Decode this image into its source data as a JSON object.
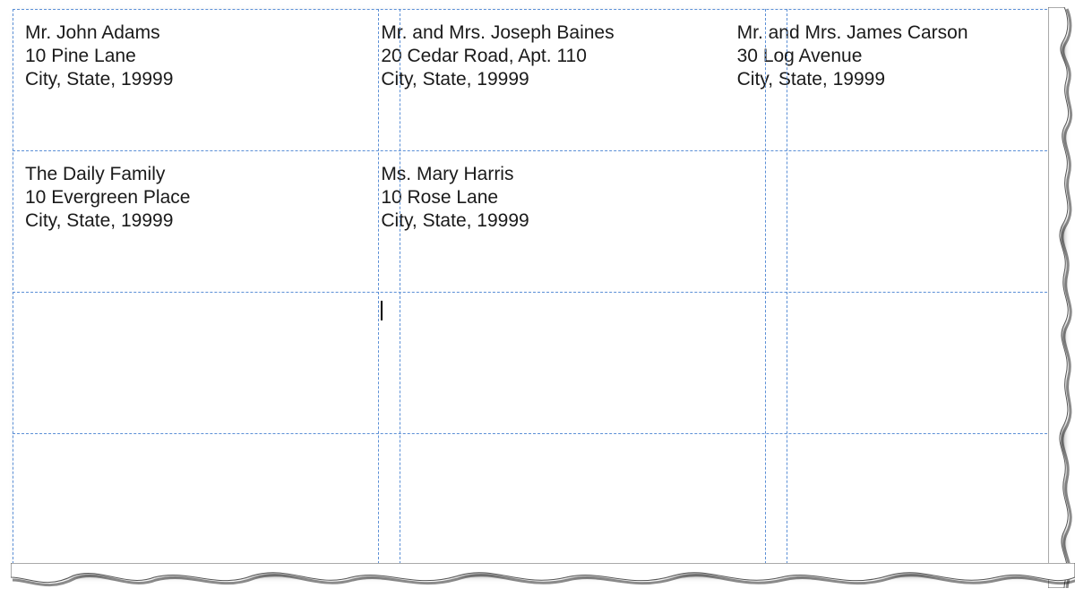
{
  "layout": {
    "columns": [
      408,
      24,
      408,
      24,
      408
    ],
    "rows": [
      158,
      158,
      158,
      158
    ]
  },
  "labels": [
    [
      {
        "name": "Mr. John Adams",
        "street": "10 Pine Lane",
        "city": "City, State, 19999"
      },
      {
        "name": "Mr. and Mrs. Joseph Baines",
        "street": "20 Cedar Road, Apt. 110",
        "city": "City, State, 19999"
      },
      {
        "name": "Mr. and Mrs. James Carson",
        "street": "30 Log Avenue",
        "city": "City, State, 19999"
      }
    ],
    [
      {
        "name": "The Daily Family",
        "street": "10 Evergreen Place",
        "city": "City, State, 19999"
      },
      {
        "name": "Ms. Mary Harris",
        "street": "10 Rose Lane",
        "city": "City, State, 19999"
      },
      {
        "name": "",
        "street": "",
        "city": ""
      }
    ],
    [
      {
        "name": "",
        "street": "",
        "city": ""
      },
      {
        "name": "",
        "street": "",
        "city": ""
      },
      {
        "name": "",
        "street": "",
        "city": ""
      }
    ],
    [
      {
        "name": "",
        "street": "",
        "city": ""
      },
      {
        "name": "",
        "street": "",
        "city": ""
      },
      {
        "name": "",
        "street": "",
        "city": ""
      }
    ]
  ],
  "cursor": {
    "row": 2,
    "col": 1
  },
  "colors": {
    "guide": "#5b8fd6",
    "text": "#1a1a1a"
  }
}
